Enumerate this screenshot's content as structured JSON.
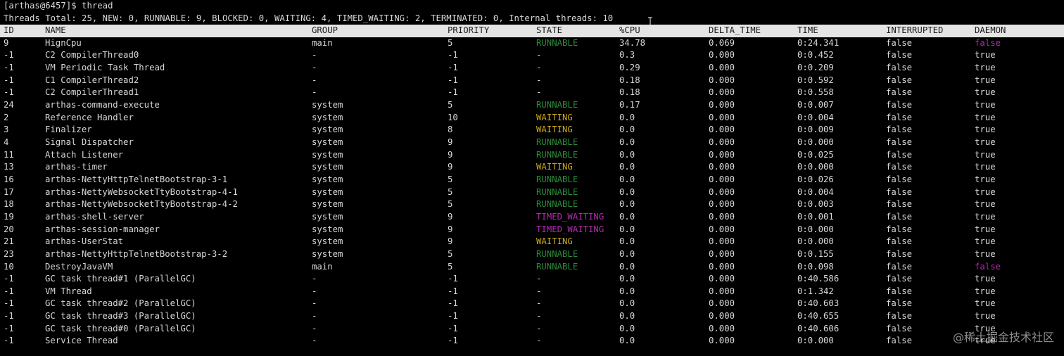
{
  "terminal": {
    "prompt": "[arthas@6457]$ thread",
    "summary": "Threads Total: 25, NEW: 0, RUNNABLE: 9, BLOCKED: 0, WAITING: 4, TIMED_WAITING: 2, TERMINATED: 0, Internal threads: 10"
  },
  "colors": {
    "background": "#000000",
    "text": "#d8d8d8",
    "header_bg": "#e4e4e4",
    "runnable": "#2c8a3a",
    "waiting": "#c9a51c",
    "timed_waiting": "#b22ab0",
    "daemon_false": "#b22ab0"
  },
  "table": {
    "columns": [
      "ID",
      "NAME",
      "GROUP",
      "PRIORITY",
      "STATE",
      "%CPU",
      "DELTA_TIME",
      "TIME",
      "INTERRUPTED",
      "DAEMON"
    ],
    "rows": [
      {
        "id": "9",
        "name": "HignCpu",
        "group": "main",
        "priority": "5",
        "state": "RUNNABLE",
        "cpu": "34.78",
        "delta": "0.069",
        "time": "0:24.341",
        "interrupted": "false",
        "daemon": "false"
      },
      {
        "id": "-1",
        "name": "C2 CompilerThread0",
        "group": "-",
        "priority": "-1",
        "state": "-",
        "cpu": "0.3",
        "delta": "0.000",
        "time": "0:0.452",
        "interrupted": "false",
        "daemon": "true"
      },
      {
        "id": "-1",
        "name": "VM Periodic Task Thread",
        "group": "-",
        "priority": "-1",
        "state": "-",
        "cpu": "0.29",
        "delta": "0.000",
        "time": "0:0.209",
        "interrupted": "false",
        "daemon": "true"
      },
      {
        "id": "-1",
        "name": "C1 CompilerThread2",
        "group": "-",
        "priority": "-1",
        "state": "-",
        "cpu": "0.18",
        "delta": "0.000",
        "time": "0:0.592",
        "interrupted": "false",
        "daemon": "true"
      },
      {
        "id": "-1",
        "name": "C2 CompilerThread1",
        "group": "-",
        "priority": "-1",
        "state": "-",
        "cpu": "0.18",
        "delta": "0.000",
        "time": "0:0.558",
        "interrupted": "false",
        "daemon": "true"
      },
      {
        "id": "24",
        "name": "arthas-command-execute",
        "group": "system",
        "priority": "5",
        "state": "RUNNABLE",
        "cpu": "0.17",
        "delta": "0.000",
        "time": "0:0.007",
        "interrupted": "false",
        "daemon": "true"
      },
      {
        "id": "2",
        "name": "Reference Handler",
        "group": "system",
        "priority": "10",
        "state": "WAITING",
        "cpu": "0.0",
        "delta": "0.000",
        "time": "0:0.004",
        "interrupted": "false",
        "daemon": "true"
      },
      {
        "id": "3",
        "name": "Finalizer",
        "group": "system",
        "priority": "8",
        "state": "WAITING",
        "cpu": "0.0",
        "delta": "0.000",
        "time": "0:0.009",
        "interrupted": "false",
        "daemon": "true"
      },
      {
        "id": "4",
        "name": "Signal Dispatcher",
        "group": "system",
        "priority": "9",
        "state": "RUNNABLE",
        "cpu": "0.0",
        "delta": "0.000",
        "time": "0:0.000",
        "interrupted": "false",
        "daemon": "true"
      },
      {
        "id": "11",
        "name": "Attach Listener",
        "group": "system",
        "priority": "9",
        "state": "RUNNABLE",
        "cpu": "0.0",
        "delta": "0.000",
        "time": "0:0.025",
        "interrupted": "false",
        "daemon": "true"
      },
      {
        "id": "13",
        "name": "arthas-timer",
        "group": "system",
        "priority": "9",
        "state": "WAITING",
        "cpu": "0.0",
        "delta": "0.000",
        "time": "0:0.000",
        "interrupted": "false",
        "daemon": "true"
      },
      {
        "id": "16",
        "name": "arthas-NettyHttpTelnetBootstrap-3-1",
        "group": "system",
        "priority": "5",
        "state": "RUNNABLE",
        "cpu": "0.0",
        "delta": "0.000",
        "time": "0:0.026",
        "interrupted": "false",
        "daemon": "true"
      },
      {
        "id": "17",
        "name": "arthas-NettyWebsocketTtyBootstrap-4-1",
        "group": "system",
        "priority": "5",
        "state": "RUNNABLE",
        "cpu": "0.0",
        "delta": "0.000",
        "time": "0:0.004",
        "interrupted": "false",
        "daemon": "true"
      },
      {
        "id": "18",
        "name": "arthas-NettyWebsocketTtyBootstrap-4-2",
        "group": "system",
        "priority": "5",
        "state": "RUNNABLE",
        "cpu": "0.0",
        "delta": "0.000",
        "time": "0:0.003",
        "interrupted": "false",
        "daemon": "true"
      },
      {
        "id": "19",
        "name": "arthas-shell-server",
        "group": "system",
        "priority": "9",
        "state": "TIMED_WAITING",
        "cpu": "0.0",
        "delta": "0.000",
        "time": "0:0.001",
        "interrupted": "false",
        "daemon": "true"
      },
      {
        "id": "20",
        "name": "arthas-session-manager",
        "group": "system",
        "priority": "9",
        "state": "TIMED_WAITING",
        "cpu": "0.0",
        "delta": "0.000",
        "time": "0:0.000",
        "interrupted": "false",
        "daemon": "true"
      },
      {
        "id": "21",
        "name": "arthas-UserStat",
        "group": "system",
        "priority": "9",
        "state": "WAITING",
        "cpu": "0.0",
        "delta": "0.000",
        "time": "0:0.000",
        "interrupted": "false",
        "daemon": "true"
      },
      {
        "id": "23",
        "name": "arthas-NettyHttpTelnetBootstrap-3-2",
        "group": "system",
        "priority": "5",
        "state": "RUNNABLE",
        "cpu": "0.0",
        "delta": "0.000",
        "time": "0:0.155",
        "interrupted": "false",
        "daemon": "true"
      },
      {
        "id": "10",
        "name": "DestroyJavaVM",
        "group": "main",
        "priority": "5",
        "state": "RUNNABLE",
        "cpu": "0.0",
        "delta": "0.000",
        "time": "0:0.098",
        "interrupted": "false",
        "daemon": "false"
      },
      {
        "id": "-1",
        "name": "GC task thread#1 (ParallelGC)",
        "group": "-",
        "priority": "-1",
        "state": "-",
        "cpu": "0.0",
        "delta": "0.000",
        "time": "0:40.586",
        "interrupted": "false",
        "daemon": "true"
      },
      {
        "id": "-1",
        "name": "VM Thread",
        "group": "-",
        "priority": "-1",
        "state": "-",
        "cpu": "0.0",
        "delta": "0.000",
        "time": "0:1.342",
        "interrupted": "false",
        "daemon": "true"
      },
      {
        "id": "-1",
        "name": "GC task thread#2 (ParallelGC)",
        "group": "-",
        "priority": "-1",
        "state": "-",
        "cpu": "0.0",
        "delta": "0.000",
        "time": "0:40.603",
        "interrupted": "false",
        "daemon": "true"
      },
      {
        "id": "-1",
        "name": "GC task thread#3 (ParallelGC)",
        "group": "-",
        "priority": "-1",
        "state": "-",
        "cpu": "0.0",
        "delta": "0.000",
        "time": "0:40.655",
        "interrupted": "false",
        "daemon": "true"
      },
      {
        "id": "-1",
        "name": "GC task thread#0 (ParallelGC)",
        "group": "-",
        "priority": "-1",
        "state": "-",
        "cpu": "0.0",
        "delta": "0.000",
        "time": "0:40.606",
        "interrupted": "false",
        "daemon": "true"
      },
      {
        "id": "-1",
        "name": "Service Thread",
        "group": "-",
        "priority": "-1",
        "state": "-",
        "cpu": "0.0",
        "delta": "0.000",
        "time": "0:0.000",
        "interrupted": "false",
        "daemon": "true"
      }
    ]
  },
  "watermark": "@稀土掘金技术社区",
  "icons": {
    "cursor": "text-cursor-icon"
  }
}
